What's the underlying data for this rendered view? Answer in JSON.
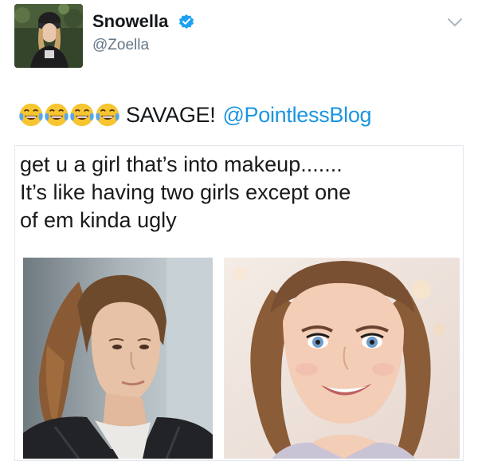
{
  "user": {
    "display_name": "Snowella",
    "handle": "@Zoella",
    "verified": true
  },
  "tweet": {
    "emojis": [
      "face-with-tears-of-joy",
      "face-with-tears-of-joy",
      "face-with-tears-of-joy",
      "face-with-tears-of-joy"
    ],
    "text": "SAVAGE!",
    "mention": "@PointlessBlog"
  },
  "media": {
    "caption_lines": [
      "get u a girl that’s into makeup.......",
      "It’s like having two girls except one",
      "of em kinda ugly"
    ]
  },
  "colors": {
    "link": "#1b95e0",
    "verified_badge": "#1da1f2",
    "secondary_text": "#657786",
    "border": "#e1e8ed"
  },
  "icons": {
    "verified": "verified-badge-icon",
    "caret": "chevron-down-icon"
  }
}
